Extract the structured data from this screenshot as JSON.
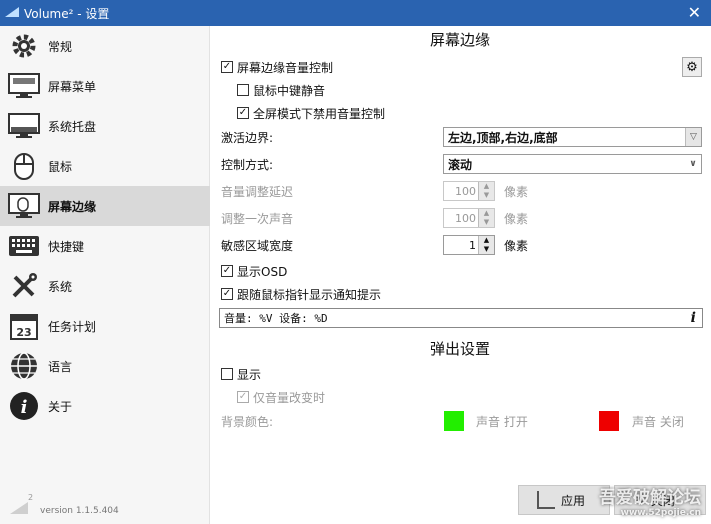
{
  "window": {
    "title": "Volume² - 设置",
    "close_label": "✕"
  },
  "sidebar": {
    "items": [
      {
        "label": "常规",
        "icon": "gear-icon"
      },
      {
        "label": "屏幕菜单",
        "icon": "monitor-menu-icon"
      },
      {
        "label": "系统托盘",
        "icon": "tray-icon"
      },
      {
        "label": "鼠标",
        "icon": "mouse-icon"
      },
      {
        "label": "屏幕边缘",
        "icon": "screen-edge-icon"
      },
      {
        "label": "快捷键",
        "icon": "keyboard-icon"
      },
      {
        "label": "系统",
        "icon": "tools-icon"
      },
      {
        "label": "任务计划",
        "icon": "calendar-icon"
      },
      {
        "label": "语言",
        "icon": "globe-icon"
      },
      {
        "label": "关于",
        "icon": "info-icon"
      }
    ],
    "active_index": 4,
    "calendar_day": "23",
    "grip_number": "2",
    "version": "version 1.1.5.404"
  },
  "edge_section": {
    "title": "屏幕边缘",
    "enable_label": "屏幕边缘音量控制",
    "enable_checked": true,
    "middle_click_mute_label": "鼠标中键静音",
    "middle_click_mute_checked": false,
    "fullscreen_disable_label": "全屏模式下禁用音量控制",
    "fullscreen_disable_checked": true,
    "active_edges_label": "激活边界:",
    "active_edges_value": "左边,顶部,右边,底部",
    "control_mode_label": "控制方式:",
    "control_mode_value": "滚动",
    "volume_delay_label": "音量调整延迟",
    "volume_delay_value": "100",
    "volume_delay_unit": "像素",
    "single_step_label": "调整一次声音",
    "single_step_value": "100",
    "single_step_unit": "像素",
    "sensitive_width_label": "敏感区域宽度",
    "sensitive_width_value": "1",
    "sensitive_width_unit": "像素",
    "show_osd_label": "显示OSD",
    "show_osd_checked": true,
    "follow_mouse_label": "跟随鼠标指针显示通知提示",
    "follow_mouse_checked": true,
    "format_text": "音量: %V   设备: %D",
    "info_glyph": "i"
  },
  "popup_section": {
    "title": "弹出设置",
    "show_label": "显示",
    "show_checked": false,
    "volume_change_only_label": "仅音量改变时",
    "volume_change_only_checked": true,
    "bg_color_label": "背景颜色:",
    "sound_on_label": "声音 打开",
    "sound_on_color": "#22ee00",
    "sound_off_label": "声音 关闭",
    "sound_off_color": "#ee0000"
  },
  "buttons": {
    "apply_label": "应用",
    "close_label": "关闭"
  },
  "watermark": {
    "text": "吾爱破解论坛",
    "url": "www.52pojie.cn"
  },
  "colors": {
    "titlebar": "#2a63b0",
    "active_item": "#d9d9d9"
  }
}
